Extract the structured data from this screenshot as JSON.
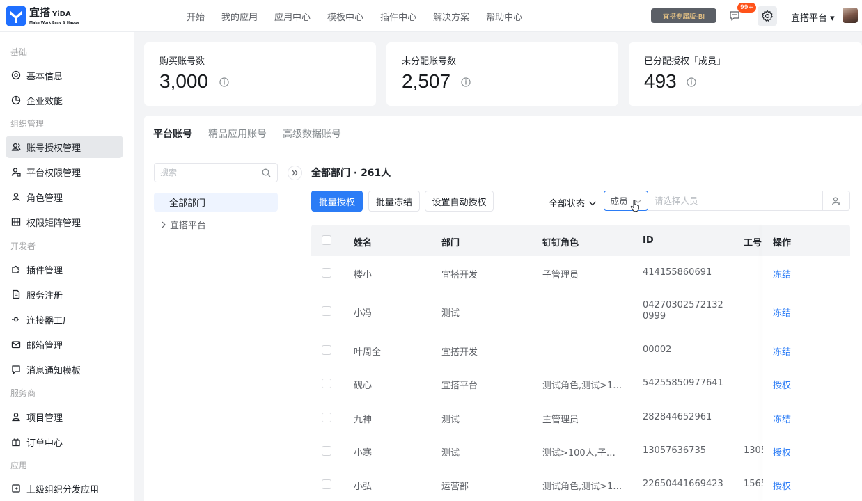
{
  "brand": {
    "name_cn": "宜搭",
    "name_en": "YiDA",
    "slogan": "Make Work Easy & Happy"
  },
  "topnav": [
    "开始",
    "我的应用",
    "应用中心",
    "模板中心",
    "插件中心",
    "解决方案",
    "帮助中心"
  ],
  "header": {
    "bi_badge": "宜搭专属版-BI",
    "notif_count": "99+",
    "platform": "宜搭平台 ▾"
  },
  "sidebar": {
    "groups": [
      "基础",
      "组织管理",
      "开发者",
      "服务商",
      "应用"
    ],
    "items": [
      {
        "label": "基本信息",
        "icon": "settings-icon"
      },
      {
        "label": "企业效能",
        "icon": "pie-chart-icon"
      },
      {
        "label": "账号授权管理",
        "icon": "users-icon"
      },
      {
        "label": "平台权限管理",
        "icon": "user-lock-icon"
      },
      {
        "label": "角色管理",
        "icon": "user-role-icon"
      },
      {
        "label": "权限矩阵管理",
        "icon": "grid-icon"
      },
      {
        "label": "插件管理",
        "icon": "puzzle-icon"
      },
      {
        "label": "服务注册",
        "icon": "doc-icon"
      },
      {
        "label": "连接器工厂",
        "icon": "connector-icon"
      },
      {
        "label": "邮箱管理",
        "icon": "mail-icon"
      },
      {
        "label": "消息通知模板",
        "icon": "message-icon"
      },
      {
        "label": "项目管理",
        "icon": "user-icon"
      },
      {
        "label": "订单中心",
        "icon": "gift-icon"
      },
      {
        "label": "上级组织分发应用",
        "icon": "distribute-icon"
      }
    ]
  },
  "stats": [
    {
      "label": "购买账号数",
      "value": "3,000"
    },
    {
      "label": "未分配账号数",
      "value": "2,507"
    },
    {
      "label": "已分配授权「成员」",
      "value": "493"
    }
  ],
  "tabs": [
    "平台账号",
    "精品应用账号",
    "高级数据账号"
  ],
  "tree": {
    "search_placeholder": "搜索",
    "all": "全部部门",
    "node": "宜搭平台"
  },
  "dept_title": "全部部门 · 261人",
  "toolbar": {
    "batch_auth": "批量授权",
    "batch_freeze": "批量冻结",
    "auto_auth": "设置自动授权",
    "status_filter": "全部状态",
    "member_select": "成员",
    "person_placeholder": "请选择人员"
  },
  "table": {
    "columns": [
      "姓名",
      "部门",
      "钉钉角色",
      "ID",
      "工号",
      "操作"
    ],
    "rows": [
      {
        "name": "楼小",
        "dept": "宜搭开发",
        "role": "子管理员",
        "id": "414155860691",
        "empno": "",
        "action": "冻结"
      },
      {
        "name": "小冯",
        "dept": "测试",
        "role": "",
        "id": "042703025721320999",
        "empno": "",
        "action": "冻结"
      },
      {
        "name": "叶周全",
        "dept": "宜搭开发",
        "role": "",
        "id": "00002",
        "empno": "",
        "action": "冻结"
      },
      {
        "name": "砚心",
        "dept": "宜搭平台",
        "role": "测试角色,测试>10...",
        "id": "54255850977641",
        "empno": "",
        "action": "授权"
      },
      {
        "name": "九神",
        "dept": "测试",
        "role": "主管理员",
        "id": "282844652961",
        "empno": "",
        "action": "冻结"
      },
      {
        "name": "小寒",
        "dept": "测试",
        "role": "测试>100人,子管...",
        "id": "13057636735",
        "empno": "1305",
        "action": "授权"
      },
      {
        "name": "小弘",
        "dept": "运营部",
        "role": "测试角色,测试>10...",
        "id": "22650441669423",
        "empno": "1565",
        "action": "授权"
      }
    ]
  },
  "colors": {
    "primary": "#2b7cf6",
    "sidebar_active": "#e6e8eb",
    "badge": "#ff5219"
  }
}
